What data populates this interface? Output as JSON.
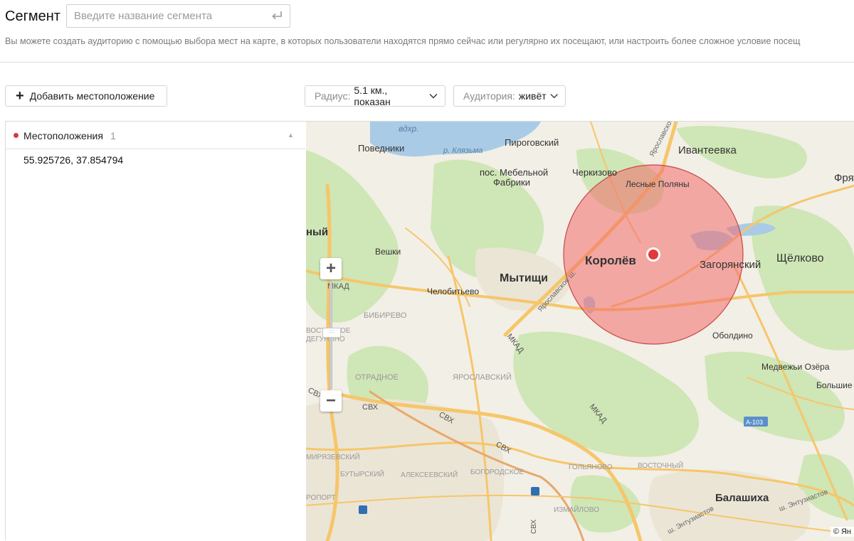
{
  "header": {
    "title": "Сегмент",
    "segment_placeholder": "Введите название сегмента",
    "description": "Вы можете создать аудиторию с помощью выбора мест на карте, в которых пользователи находятся прямо сейчас или регулярно их посещают, или настроить более сложное условие посещ"
  },
  "toolbar": {
    "add_location_label": "Добавить местоположение",
    "radius_label": "Радиус:",
    "radius_value": "5.1 км., показан",
    "audience_label": "Аудитория:",
    "audience_value": "живёт"
  },
  "locations_panel": {
    "title": "Местоположения",
    "count": "1",
    "items": [
      "55.925726, 37.854794"
    ]
  },
  "map": {
    "labels": {
      "vdhr": "вдхр.",
      "povedniki": "Поведники",
      "klyazma": "р. Клязьма",
      "pirogovsky": "Пироговский",
      "ivanteevka": "Ивантеевка",
      "frya": "Фря",
      "mebelnoy": "пос. Мебельной",
      "fabriki": "Фабрики",
      "cherkizovo": "Черкизово",
      "lesnye_polyany": "Лесные Поляны",
      "yaroslavskoe_top": "Ярославское",
      "nyi": "ный",
      "veshki": "Вешки",
      "korolev": "Королёв",
      "zagoryansky": "Загорянский",
      "shchelkovo": "Щёлково",
      "mytishchi": "Мытищи",
      "mkad1": "МКАД",
      "chelobitevo": "Челобитьево",
      "yaroslavskoe_sh": "Ярославское ш.",
      "bibirevo": "БИБИРЕВО",
      "vostochnoe": "ВОСТОЧНОЕ",
      "degunino": "ДЕГУНИНО",
      "mkad2": "МКАД",
      "oboldino": "Оболдино",
      "medvezhi": "Медвежьи Озёра",
      "bolshie": "Большие",
      "otradnoe": "ОТРАДНОЕ",
      "yaroslavsky": "ЯРОСЛАВСКИЙ",
      "svh1": "СВХ",
      "svh2": "СВХ",
      "svh3": "СВХ",
      "svh4": "СВХ",
      "mkad3": "МКАД",
      "a103": "А-103",
      "miryazevsky": "МИРЯЗЕВСКИЙ",
      "butyrsky": "БУТЫРСКИЙ",
      "alekseevsky": "АЛЕКСЕЕВСКИЙ",
      "bogorodskoe": "БОГОРОДСКОЕ",
      "golyanovo": "ГОЛЬЯНОВО",
      "vostochny": "ВОСТОЧНЫЙ",
      "balashikha": "Балашиха",
      "entuziastov1": "ш. Энтузиастов",
      "entuziastov2": "ш. Энтузиастов",
      "aeroport": "РОПОРТ",
      "izmailovo": "ИЗМАЙЛОВО",
      "svh_vert": "СВХ"
    },
    "copyright": "© Ян"
  },
  "colors": {
    "accent_red": "#d43b3b",
    "circle_fill": "#f26b6b",
    "water": "#a9cbe6",
    "forest": "#cfe6b6",
    "road": "#f6c66a"
  }
}
